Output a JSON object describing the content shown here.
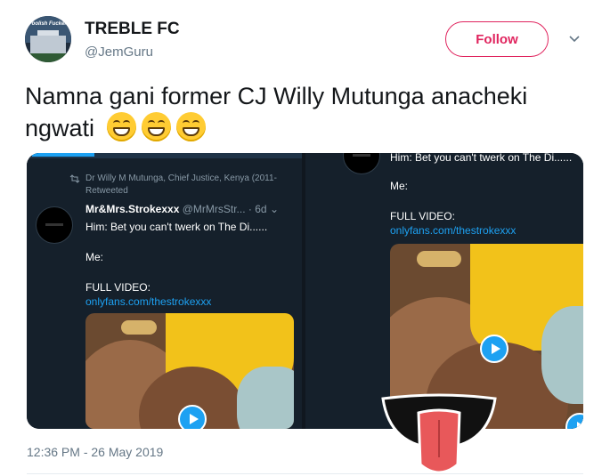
{
  "header": {
    "display_name": "TREBLE FC",
    "handle": "@JemGuru",
    "avatar_text": "Foolish Fuckers",
    "follow_label": "Follow"
  },
  "tweet": {
    "text": "Namna gani former CJ Willy Mutunga anacheki ngwati",
    "emojis": [
      "grinning-face-icon",
      "grinning-face-icon",
      "grinning-face-icon"
    ],
    "timestamp": "12:36 PM - 26 May 2019"
  },
  "media": {
    "left": {
      "retweeted_by": "Dr Willy M Mutunga, Chief Justice, Kenya (2011-",
      "retweeted_suffix": "Retweeted",
      "author": "Mr&Mrs.Strokexxx",
      "author_handle": "@MrMrsStr...",
      "age": "· 6d",
      "line1": "Him: Bet you can't twerk on The Di......",
      "line2": "Me:",
      "line3": "FULL VIDEO:",
      "link": "onlyfans.com/thestrokexxx"
    },
    "right": {
      "line1": "Him: Bet you can't twerk on The Di......",
      "line2": "Me:",
      "line3": "FULL VIDEO:",
      "link": "onlyfans.com/thestrokexxx"
    }
  },
  "colors": {
    "accent": "#1da1f2",
    "follow": "#e0245e",
    "dark_bg": "#15202b"
  }
}
